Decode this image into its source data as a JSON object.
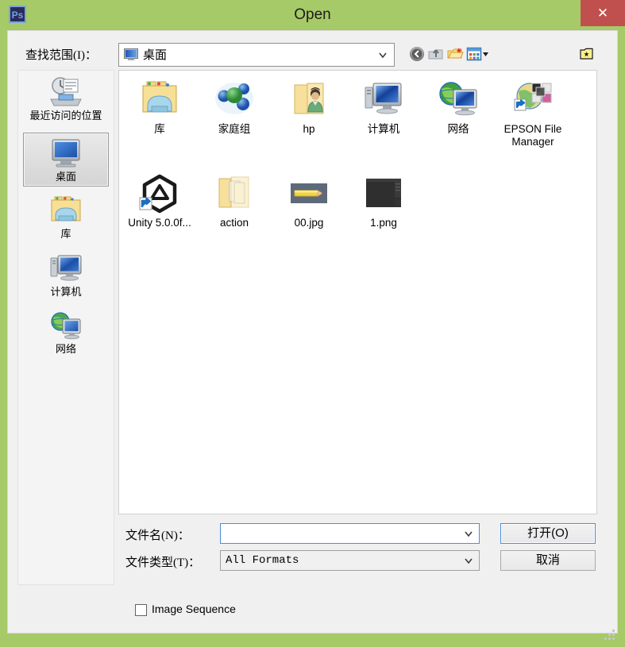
{
  "window": {
    "title": "Open",
    "app_icon": "photoshop-icon",
    "close_label": "✕",
    "frame_color": "#a6ca67",
    "titlebar_text_color": "#1d1d1d",
    "close_button_color": "#c0504d",
    "body_color": "#f0f0f0"
  },
  "lookin": {
    "label": "查找范围(I)：",
    "value": "桌面",
    "icon": "desktop-monitor-icon",
    "chevron": "chevron-down-icon"
  },
  "toolbar": {
    "back": "back-arrow-icon",
    "up": "up-one-level-icon",
    "new_folder": "new-folder-icon",
    "views": "views-icon",
    "corner": "folder-star-icon"
  },
  "places": [
    {
      "label": "最近访问的位置",
      "icon": "recent-places-icon",
      "selected": false
    },
    {
      "label": "桌面",
      "icon": "desktop-icon",
      "selected": true
    },
    {
      "label": "库",
      "icon": "libraries-icon",
      "selected": false
    },
    {
      "label": "计算机",
      "icon": "computer-icon",
      "selected": false
    },
    {
      "label": "网络",
      "icon": "network-icon",
      "selected": false
    }
  ],
  "files": [
    {
      "name": "库",
      "icon": "libraries-folder-icon",
      "type": "folder"
    },
    {
      "name": "家庭组",
      "icon": "homegroup-icon",
      "type": "special"
    },
    {
      "name": "hp",
      "icon": "user-folder-icon",
      "type": "folder"
    },
    {
      "name": "计算机",
      "icon": "computer-icon",
      "type": "special"
    },
    {
      "name": "网络",
      "icon": "network-icon",
      "type": "special"
    },
    {
      "name": "EPSON File Manager",
      "icon": "epson-file-manager-icon",
      "type": "shortcut"
    },
    {
      "name": "Unity 5.0.0f...",
      "icon": "unity-icon",
      "type": "shortcut"
    },
    {
      "name": "action",
      "icon": "folder-icon",
      "type": "folder"
    },
    {
      "name": "00.jpg",
      "icon": "image-thumbnail-pencil",
      "type": "file"
    },
    {
      "name": "1.png",
      "icon": "image-thumbnail-dark",
      "type": "file"
    }
  ],
  "form": {
    "filename_label": "文件名(N)：",
    "filename_value": "",
    "filetype_label": "文件类型(T)：",
    "filetype_value": "All Formats",
    "chevron": "chevron-down-icon"
  },
  "buttons": {
    "open": "打开(O)",
    "cancel": "取消"
  },
  "options": {
    "image_sequence_label": "Image Sequence",
    "image_sequence_checked": false
  },
  "misc": {
    "resize_grip": "resize-grip-icon"
  }
}
